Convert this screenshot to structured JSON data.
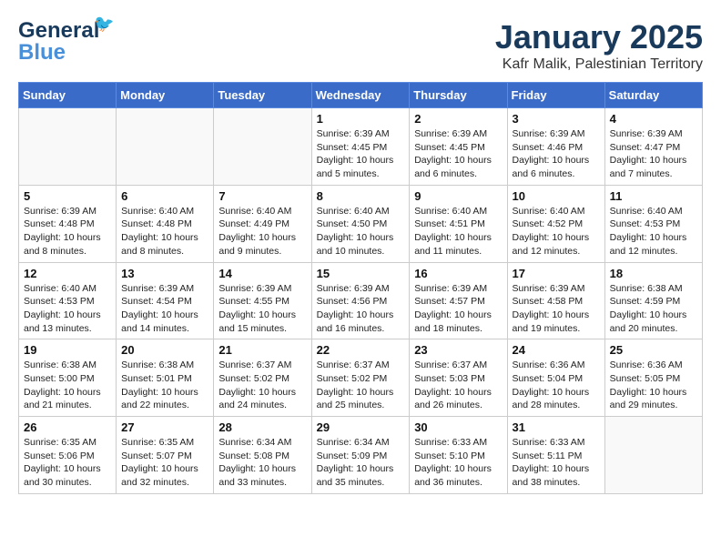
{
  "header": {
    "logo_line1": "General",
    "logo_line2": "Blue",
    "month_title": "January 2025",
    "subtitle": "Kafr Malik, Palestinian Territory"
  },
  "weekdays": [
    "Sunday",
    "Monday",
    "Tuesday",
    "Wednesday",
    "Thursday",
    "Friday",
    "Saturday"
  ],
  "weeks": [
    [
      {
        "day": "",
        "content": ""
      },
      {
        "day": "",
        "content": ""
      },
      {
        "day": "",
        "content": ""
      },
      {
        "day": "1",
        "content": "Sunrise: 6:39 AM\nSunset: 4:45 PM\nDaylight: 10 hours\nand 5 minutes."
      },
      {
        "day": "2",
        "content": "Sunrise: 6:39 AM\nSunset: 4:45 PM\nDaylight: 10 hours\nand 6 minutes."
      },
      {
        "day": "3",
        "content": "Sunrise: 6:39 AM\nSunset: 4:46 PM\nDaylight: 10 hours\nand 6 minutes."
      },
      {
        "day": "4",
        "content": "Sunrise: 6:39 AM\nSunset: 4:47 PM\nDaylight: 10 hours\nand 7 minutes."
      }
    ],
    [
      {
        "day": "5",
        "content": "Sunrise: 6:39 AM\nSunset: 4:48 PM\nDaylight: 10 hours\nand 8 minutes."
      },
      {
        "day": "6",
        "content": "Sunrise: 6:40 AM\nSunset: 4:48 PM\nDaylight: 10 hours\nand 8 minutes."
      },
      {
        "day": "7",
        "content": "Sunrise: 6:40 AM\nSunset: 4:49 PM\nDaylight: 10 hours\nand 9 minutes."
      },
      {
        "day": "8",
        "content": "Sunrise: 6:40 AM\nSunset: 4:50 PM\nDaylight: 10 hours\nand 10 minutes."
      },
      {
        "day": "9",
        "content": "Sunrise: 6:40 AM\nSunset: 4:51 PM\nDaylight: 10 hours\nand 11 minutes."
      },
      {
        "day": "10",
        "content": "Sunrise: 6:40 AM\nSunset: 4:52 PM\nDaylight: 10 hours\nand 12 minutes."
      },
      {
        "day": "11",
        "content": "Sunrise: 6:40 AM\nSunset: 4:53 PM\nDaylight: 10 hours\nand 12 minutes."
      }
    ],
    [
      {
        "day": "12",
        "content": "Sunrise: 6:40 AM\nSunset: 4:53 PM\nDaylight: 10 hours\nand 13 minutes."
      },
      {
        "day": "13",
        "content": "Sunrise: 6:39 AM\nSunset: 4:54 PM\nDaylight: 10 hours\nand 14 minutes."
      },
      {
        "day": "14",
        "content": "Sunrise: 6:39 AM\nSunset: 4:55 PM\nDaylight: 10 hours\nand 15 minutes."
      },
      {
        "day": "15",
        "content": "Sunrise: 6:39 AM\nSunset: 4:56 PM\nDaylight: 10 hours\nand 16 minutes."
      },
      {
        "day": "16",
        "content": "Sunrise: 6:39 AM\nSunset: 4:57 PM\nDaylight: 10 hours\nand 18 minutes."
      },
      {
        "day": "17",
        "content": "Sunrise: 6:39 AM\nSunset: 4:58 PM\nDaylight: 10 hours\nand 19 minutes."
      },
      {
        "day": "18",
        "content": "Sunrise: 6:38 AM\nSunset: 4:59 PM\nDaylight: 10 hours\nand 20 minutes."
      }
    ],
    [
      {
        "day": "19",
        "content": "Sunrise: 6:38 AM\nSunset: 5:00 PM\nDaylight: 10 hours\nand 21 minutes."
      },
      {
        "day": "20",
        "content": "Sunrise: 6:38 AM\nSunset: 5:01 PM\nDaylight: 10 hours\nand 22 minutes."
      },
      {
        "day": "21",
        "content": "Sunrise: 6:37 AM\nSunset: 5:02 PM\nDaylight: 10 hours\nand 24 minutes."
      },
      {
        "day": "22",
        "content": "Sunrise: 6:37 AM\nSunset: 5:02 PM\nDaylight: 10 hours\nand 25 minutes."
      },
      {
        "day": "23",
        "content": "Sunrise: 6:37 AM\nSunset: 5:03 PM\nDaylight: 10 hours\nand 26 minutes."
      },
      {
        "day": "24",
        "content": "Sunrise: 6:36 AM\nSunset: 5:04 PM\nDaylight: 10 hours\nand 28 minutes."
      },
      {
        "day": "25",
        "content": "Sunrise: 6:36 AM\nSunset: 5:05 PM\nDaylight: 10 hours\nand 29 minutes."
      }
    ],
    [
      {
        "day": "26",
        "content": "Sunrise: 6:35 AM\nSunset: 5:06 PM\nDaylight: 10 hours\nand 30 minutes."
      },
      {
        "day": "27",
        "content": "Sunrise: 6:35 AM\nSunset: 5:07 PM\nDaylight: 10 hours\nand 32 minutes."
      },
      {
        "day": "28",
        "content": "Sunrise: 6:34 AM\nSunset: 5:08 PM\nDaylight: 10 hours\nand 33 minutes."
      },
      {
        "day": "29",
        "content": "Sunrise: 6:34 AM\nSunset: 5:09 PM\nDaylight: 10 hours\nand 35 minutes."
      },
      {
        "day": "30",
        "content": "Sunrise: 6:33 AM\nSunset: 5:10 PM\nDaylight: 10 hours\nand 36 minutes."
      },
      {
        "day": "31",
        "content": "Sunrise: 6:33 AM\nSunset: 5:11 PM\nDaylight: 10 hours\nand 38 minutes."
      },
      {
        "day": "",
        "content": ""
      }
    ]
  ]
}
